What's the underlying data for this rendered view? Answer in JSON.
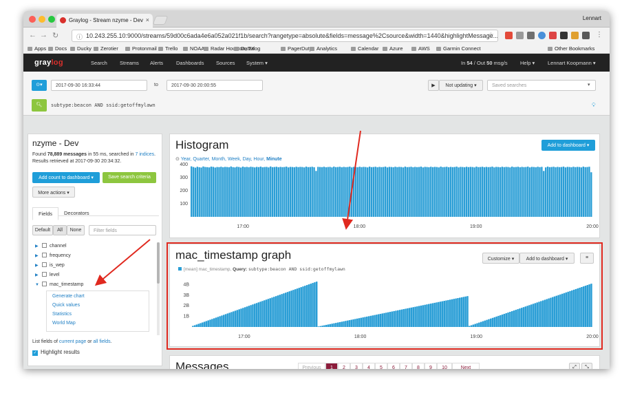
{
  "browser": {
    "tab_title": "Graylog - Stream nzyme - Dev",
    "profile": "Lennart",
    "url": "10.243.255.10:9000/streams/59d00c6ada4e6a052a021f1b/search?rangetype=absolute&fields=message%2Csource&width=1440&highlightMessage...",
    "bookmarks": [
      "Apps",
      "Docs",
      "Ducky",
      "Zerotier",
      "Protonmail",
      "Trello",
      "NOAA",
      "Radar Houston, TX",
      "Datadog",
      "PagerDuty",
      "Analytics",
      "Calendar",
      "Azure",
      "AWS",
      "Garmin Connect",
      "Other Bookmarks"
    ]
  },
  "nav": {
    "logo_pre": "gray",
    "logo_post": "log",
    "links": [
      "Search",
      "Streams",
      "Alerts",
      "Dashboards",
      "Sources",
      "System ▾"
    ],
    "throughput_in_label": "In",
    "throughput_in": "54",
    "throughput_sep": "/ Out",
    "throughput_out": "50",
    "throughput_unit": "msg/s",
    "help": "Help ▾",
    "user": "Lennart Koopmann ▾"
  },
  "search": {
    "from": "2017-09-30 16:33:44",
    "to_label": "to",
    "to": "2017-09-30 20:00:55",
    "refresh": "Not updating ▾",
    "saved_placeholder": "Saved searches",
    "query": "subtype:beacon AND ssid:getoffmylawn"
  },
  "sidebar": {
    "title": "nzyme - Dev",
    "found_pre": "Found",
    "found_count": "78,889 messages",
    "found_mid": "in 55 ms, searched in",
    "indices": "7 indices",
    "retrieved": "Results retrieved at 2017-09-30 20:34:32.",
    "add_count_btn": "Add count to dashboard ▾",
    "save_btn": "Save search criteria",
    "more_actions": "More actions ▾",
    "tab_fields": "Fields",
    "tab_decorators": "Decorators",
    "filter_default": "Default",
    "filter_all": "All",
    "filter_none": "None",
    "filter_placeholder": "Filter fields",
    "fields": [
      "channel",
      "frequency",
      "is_wep",
      "level",
      "mac_timestamp"
    ],
    "submenu": [
      "Generate chart",
      "Quick values",
      "Statistics",
      "World Map"
    ],
    "list_pre": "List fields of",
    "current_page": "current page",
    "list_or": "or",
    "all_fields": "all fields",
    "highlight": "Highlight results"
  },
  "histogram": {
    "title": "Histogram",
    "add_btn": "Add to dashboard ▾",
    "resolutions": [
      "Year",
      "Quarter",
      "Month",
      "Week",
      "Day",
      "Hour",
      "Minute"
    ],
    "active_resolution": "Minute"
  },
  "mac_graph": {
    "title": "mac_timestamp graph",
    "legend": "[mean] mac_timestamp,",
    "query_label": "Query:",
    "query": "subtype:beacon AND ssid:getoffmylawn",
    "customize_btn": "Customize ▾",
    "add_btn": "Add to dashboard ▾"
  },
  "messages": {
    "title": "Messages",
    "pages": [
      "Previous",
      "1",
      "2",
      "3",
      "4",
      "5",
      "6",
      "7",
      "8",
      "9",
      "10",
      "Next"
    ],
    "active_page": "1"
  },
  "colors": {
    "bar": "#2a9ed6",
    "accent": "#1f9ed9",
    "highlight": "#e0291f",
    "nav_bg": "#222222"
  },
  "chart_data": [
    {
      "type": "bar",
      "title": "Histogram",
      "x_ticks": [
        "17:00",
        "18:00",
        "19:00",
        "20:00"
      ],
      "y_ticks": [
        "100",
        "200",
        "300",
        "400"
      ],
      "ylim": [
        0,
        420
      ],
      "x_range": [
        "16:33",
        "20:00"
      ],
      "values": [
        385,
        380,
        375,
        382,
        378,
        376,
        384,
        380,
        379,
        377,
        383,
        381,
        376,
        380,
        379,
        382,
        378,
        381,
        380,
        378,
        384,
        379,
        377,
        382,
        380,
        376,
        383,
        379,
        381,
        378,
        382,
        380,
        377,
        381,
        379,
        383,
        378,
        380,
        381,
        377,
        384,
        379,
        380,
        382,
        378,
        381,
        379,
        380,
        383,
        377,
        381,
        380,
        378,
        382,
        379,
        381,
        380,
        377,
        383,
        379,
        380,
        382,
        378,
        350,
        381,
        380,
        379,
        382,
        378,
        380,
        381,
        377,
        383,
        379,
        380,
        382,
        378,
        381,
        379,
        380,
        383,
        377,
        381,
        380,
        378,
        382,
        379,
        381,
        380,
        377,
        383,
        379,
        380,
        382,
        378,
        381,
        379,
        380,
        383,
        377,
        381,
        380,
        378,
        382,
        379,
        381,
        380,
        377,
        383,
        379,
        380,
        382,
        378,
        381,
        379,
        380,
        383,
        377,
        381,
        380,
        378,
        382,
        379,
        381,
        380,
        377,
        383,
        379,
        380,
        382,
        378,
        381,
        379,
        380,
        383,
        377,
        381,
        380,
        378,
        382,
        379,
        381,
        380,
        377,
        383,
        379,
        380,
        382,
        378,
        381,
        379,
        380,
        383,
        377,
        381,
        380,
        378,
        382,
        379,
        381,
        380,
        377,
        383,
        379,
        380,
        382,
        378,
        381,
        379,
        380,
        383,
        377,
        381,
        380,
        378,
        382,
        379,
        381,
        350,
        377,
        383,
        379,
        380,
        382,
        378,
        381,
        379,
        380,
        383,
        377,
        381,
        380,
        378,
        382,
        379,
        381,
        380,
        377,
        383,
        379,
        380,
        382,
        340
      ]
    },
    {
      "type": "bar",
      "title": "mac_timestamp graph",
      "series": [
        {
          "name": "[mean] mac_timestamp",
          "values": []
        }
      ],
      "x_ticks": [
        "17:00",
        "18:00",
        "19:00",
        "20:00"
      ],
      "y_ticks": [
        "1B",
        "2B",
        "3B",
        "4B"
      ],
      "ylim": [
        0,
        5.2
      ],
      "unit": "B",
      "segments": [
        {
          "x_start": "16:33",
          "x_end": "17:38",
          "y_start": 0.1,
          "y_end": 4.35
        },
        {
          "x_start": "17:38",
          "x_end": "18:56",
          "y_start": 0.05,
          "y_end": 2.95
        },
        {
          "x_start": "18:56",
          "x_end": "20:00",
          "y_start": 0.1,
          "y_end": 4.15
        }
      ]
    }
  ]
}
